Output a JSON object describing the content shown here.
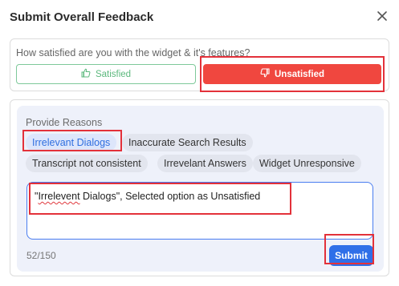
{
  "dialog": {
    "title": "Submit Overall Feedback"
  },
  "satisfaction": {
    "question": "How satisfied are you with the widget & it's features?",
    "satisfied_label": "Satisfied",
    "unsatisfied_label": "Unsatisfied",
    "selected": "Unsatisfied"
  },
  "reasons": {
    "label": "Provide Reasons",
    "options": [
      "Irrelevant Dialogs",
      "Inaccurate Search Results",
      "Transcript not consistent",
      "Irrevelant Answers",
      "Widget Unresponsive"
    ],
    "selected": "Irrelevant Dialogs"
  },
  "comment": {
    "value_prefix": "\"",
    "value_misspelled": "Irrelevent",
    "value_suffix": " Dialogs\", Selected option as Unsatisfied",
    "counter": "52/150"
  },
  "submit_label": "Submit",
  "colors": {
    "accent_blue": "#2f6fe8",
    "unsatisfied_red": "#f0473f",
    "satisfied_green": "#5cb87d",
    "highlight_red": "#e3313a"
  }
}
